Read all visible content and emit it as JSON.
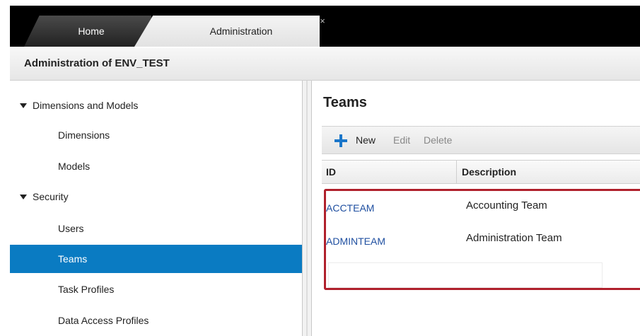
{
  "tabs": [
    {
      "label": "Home"
    },
    {
      "label": "Administration"
    }
  ],
  "tab_close": "×",
  "page_title": "Administration of ENV_TEST",
  "sidebar": {
    "groups": [
      {
        "label": "Dimensions and Models",
        "items": [
          "Dimensions",
          "Models"
        ]
      },
      {
        "label": "Security",
        "items": [
          "Users",
          "Teams",
          "Task Profiles",
          "Data Access Profiles"
        ]
      }
    ],
    "selected": "Teams"
  },
  "main": {
    "title": "Teams",
    "toolbar": {
      "new": "New",
      "edit": "Edit",
      "delete": "Delete"
    },
    "columns": [
      "ID",
      "Description"
    ],
    "rows": [
      {
        "id": "ACCTEAM",
        "description": "Accounting Team"
      },
      {
        "id": "ADMINTEAM",
        "description": "Administration Team"
      }
    ]
  },
  "colors": {
    "selection": "#0a7bc2",
    "link": "#1f4fa0",
    "highlight_border": "#b0202c",
    "add_icon": "#1a76c9"
  },
  "icons": [
    "close-icon",
    "caret-down-icon",
    "plus-icon"
  ]
}
